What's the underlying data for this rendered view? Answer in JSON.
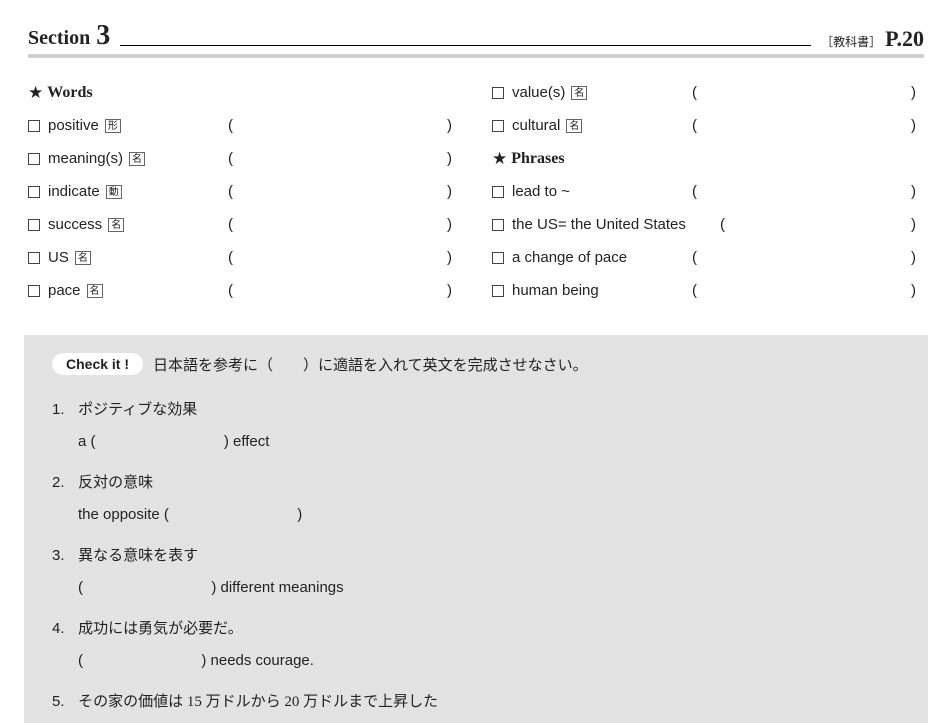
{
  "header": {
    "section_label": "Section",
    "section_number": "3",
    "textbook_ref": "［教科書］",
    "page_label": "P.20"
  },
  "words_heading": "Words",
  "phrases_heading": "Phrases",
  "left_words": [
    {
      "term": "positive",
      "pos": "形"
    },
    {
      "term": "meaning(s)",
      "pos": "名"
    },
    {
      "term": "indicate",
      "pos": "動"
    },
    {
      "term": "success",
      "pos": "名"
    },
    {
      "term": "US",
      "pos": "名"
    },
    {
      "term": "pace",
      "pos": "名"
    }
  ],
  "right_words": [
    {
      "term": "value(s)",
      "pos": "名"
    },
    {
      "term": "cultural",
      "pos": "名"
    }
  ],
  "right_phrases": [
    {
      "term": "lead to ~"
    },
    {
      "term": "the US= the United States"
    },
    {
      "term": "a change of pace"
    },
    {
      "term": "human being"
    }
  ],
  "paren": {
    "open": "(",
    "close": ")"
  },
  "check": {
    "title": "Check it !",
    "instruction": "日本語を参考に（　　）に適語を入れて英文を完成させなさい。",
    "items": [
      {
        "num": "1.",
        "jp": "ポジティブな効果",
        "en_pre": "a (",
        "en_post": ") effect"
      },
      {
        "num": "2.",
        "jp": "反対の意味",
        "en_pre": "the opposite (",
        "en_post": ")"
      },
      {
        "num": "3.",
        "jp": "異なる意味を表す",
        "en_pre": "(",
        "en_post": ") different meanings"
      },
      {
        "num": "4.",
        "jp": "成功には勇気が必要だ。",
        "en_pre": "(",
        "en_post": ") needs courage."
      },
      {
        "num": "5.",
        "jp": "その家の価値は 15 万ドルから 20 万ドルまで上昇した",
        "en_pre": "",
        "en_post": ""
      }
    ]
  }
}
